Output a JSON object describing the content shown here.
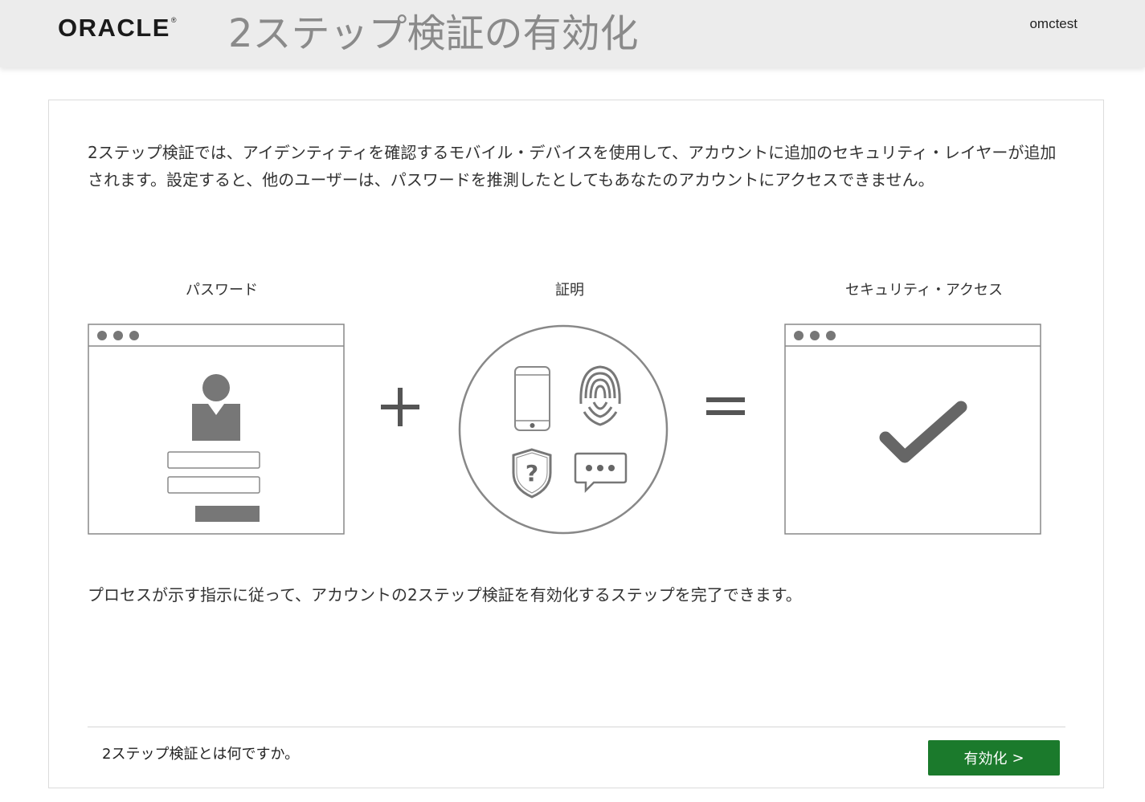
{
  "header": {
    "logo": "ORACLE",
    "logo_mark": "®",
    "title": "2ステップ検証の有効化",
    "username": "omctest"
  },
  "main": {
    "intro": "2ステップ検証では、アイデンティティを確認するモバイル・デバイスを使用して、アカウントに追加のセキュリティ・レイヤーが追加されます。設定すると、他のユーザーは、パスワードを推測したとしてもあなたのアカウントにアクセスできません。",
    "diagram": {
      "password_label": "パスワード",
      "proof_label": "証明",
      "access_label": "セキュリティ・アクセス",
      "plus_symbol": "+",
      "equals_symbol": "="
    },
    "instructions": "プロセスが示す指示に従って、アカウントの2ステップ検証を有効化するステップを完了できます。"
  },
  "footer": {
    "help_link": "2ステップ検証とは何ですか。",
    "enable_button": "有効化",
    "enable_chevron": ">"
  },
  "colors": {
    "accent": "#1b7a2c",
    "icon_gray": "#777777",
    "header_bg": "#ececec"
  }
}
